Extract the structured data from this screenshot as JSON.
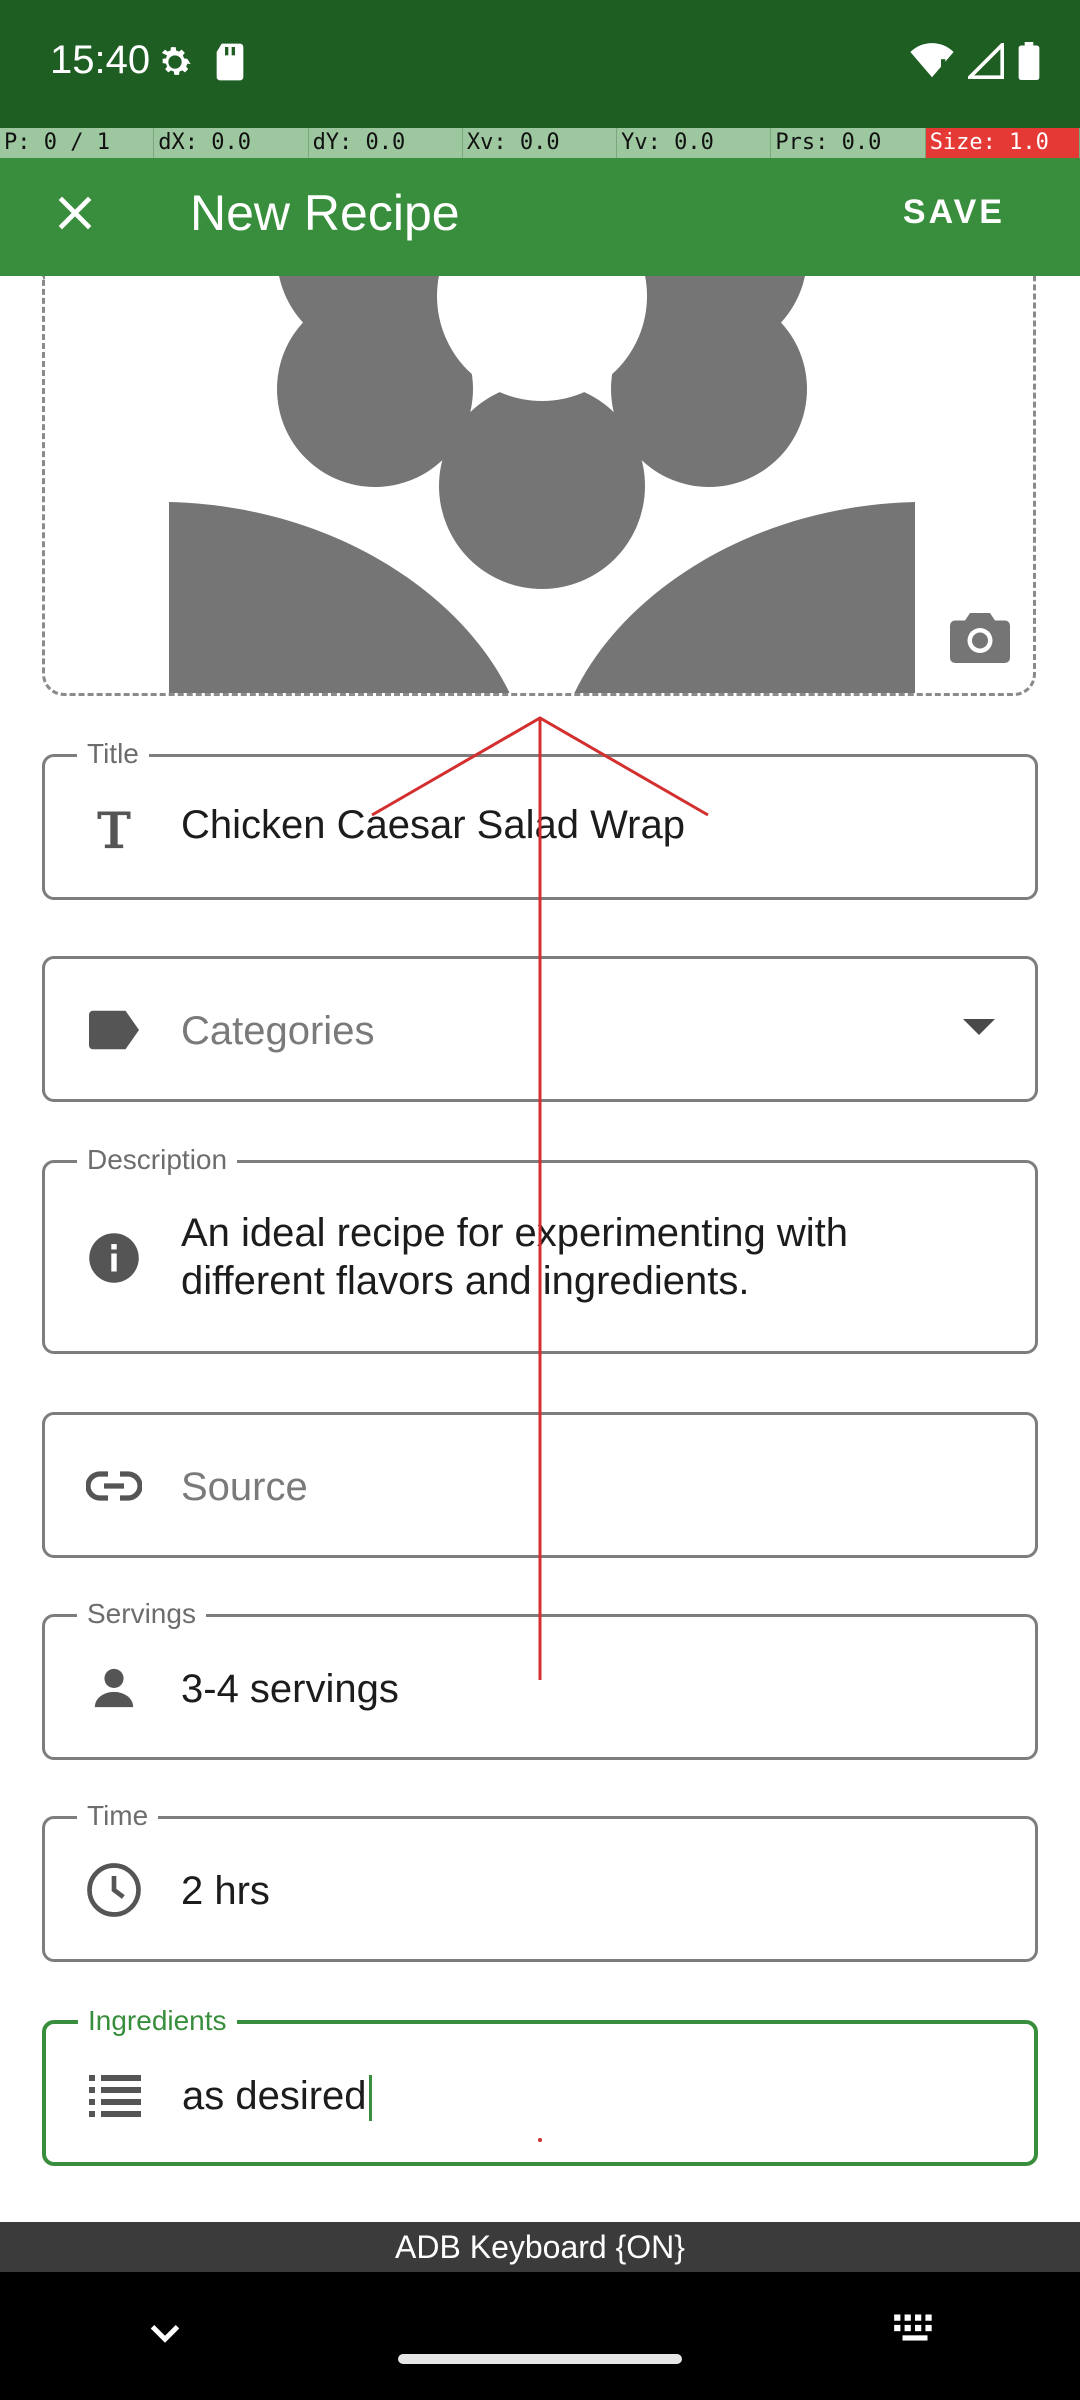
{
  "status_bar": {
    "time": "15:40",
    "icons_left": [
      "settings-icon",
      "sd-card-icon"
    ],
    "icons_right": [
      "wifi-alert-icon",
      "signal-icon",
      "battery-icon"
    ]
  },
  "debug_bar": {
    "cells": [
      "P: 0 / 1",
      "dX: 0.0",
      "dY: 0.0",
      "Xv: 0.0",
      "Yv: 0.0",
      "Prs: 0.0",
      "Size: 1.0"
    ]
  },
  "app_bar": {
    "title": "New Recipe",
    "save_label": "SAVE",
    "close_icon": "close-icon"
  },
  "photo": {
    "placeholder_icon": "flower-placeholder-icon",
    "camera_icon": "camera-icon"
  },
  "form": {
    "title": {
      "label": "Title",
      "value": "Chicken Caesar Salad Wrap",
      "icon": "title-text-icon"
    },
    "categories": {
      "placeholder": "Categories",
      "icon": "label-tag-icon"
    },
    "description": {
      "label": "Description",
      "value": "An ideal recipe for experimenting with different flavors and ingredients.",
      "icon": "info-icon"
    },
    "source": {
      "placeholder": "Source",
      "icon": "link-icon"
    },
    "servings": {
      "label": "Servings",
      "value": "3-4 servings",
      "icon": "person-icon"
    },
    "time": {
      "label": "Time",
      "value": "2 hrs",
      "icon": "clock-icon"
    },
    "ingredients": {
      "label": "Ingredients",
      "value": "as desired",
      "icon": "list-icon"
    }
  },
  "keyboard": {
    "label": "ADB Keyboard {ON}"
  },
  "colors": {
    "primary": "#388e3c",
    "status_bar": "#1e5e23",
    "debug_alert": "#e53935",
    "gesture_trace": "#d32f2f"
  }
}
